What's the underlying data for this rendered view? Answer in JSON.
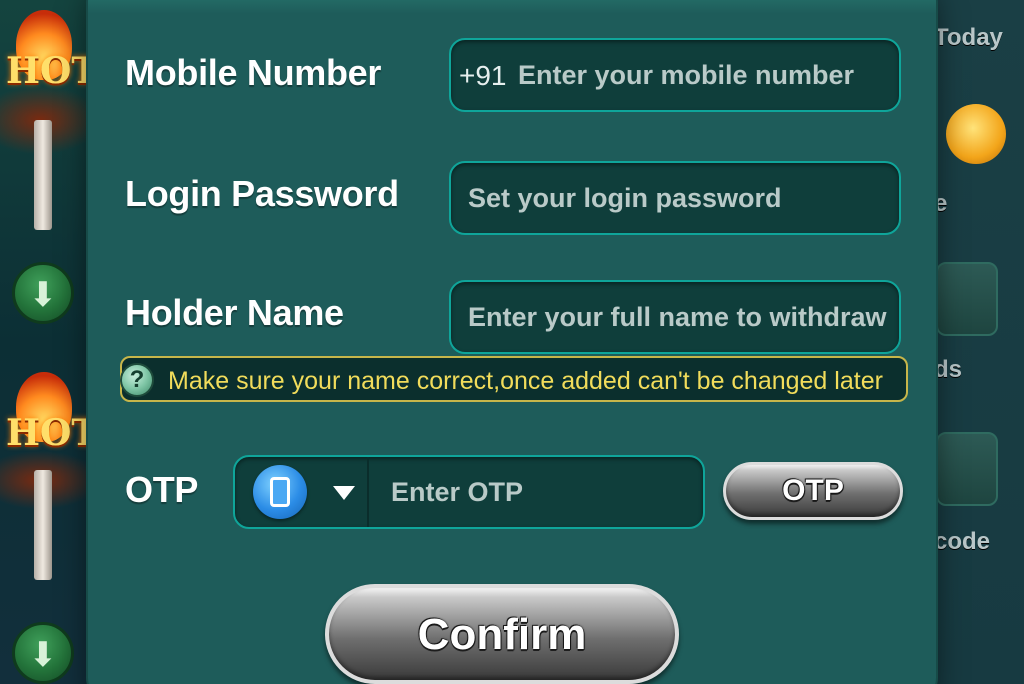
{
  "form": {
    "mobile": {
      "label": "Mobile Number",
      "prefix": "+91",
      "placeholder": "Enter your mobile number"
    },
    "password": {
      "label": "Login Password",
      "placeholder": "Set your login password"
    },
    "holder": {
      "label": "Holder Name",
      "placeholder": "Enter your full name to withdraw"
    },
    "notice": {
      "icon": "?",
      "text": "Make sure your name correct,once added can't be changed later"
    },
    "otp": {
      "label": "OTP",
      "placeholder": "Enter OTP",
      "button_label": "OTP"
    },
    "confirm_label": "Confirm"
  },
  "background": {
    "left_badges": [
      "HOT",
      "HOT"
    ],
    "right_labels": [
      "Today",
      "e",
      "ds",
      "code"
    ]
  },
  "colors": {
    "panel": "#1e5c5a",
    "field_border": "#0fa59a",
    "notice_text": "#f1dc5b",
    "notice_border": "#c7b64a"
  },
  "icons": [
    "download-icon",
    "phone-icon",
    "dropdown-caret-icon",
    "question-icon"
  ]
}
